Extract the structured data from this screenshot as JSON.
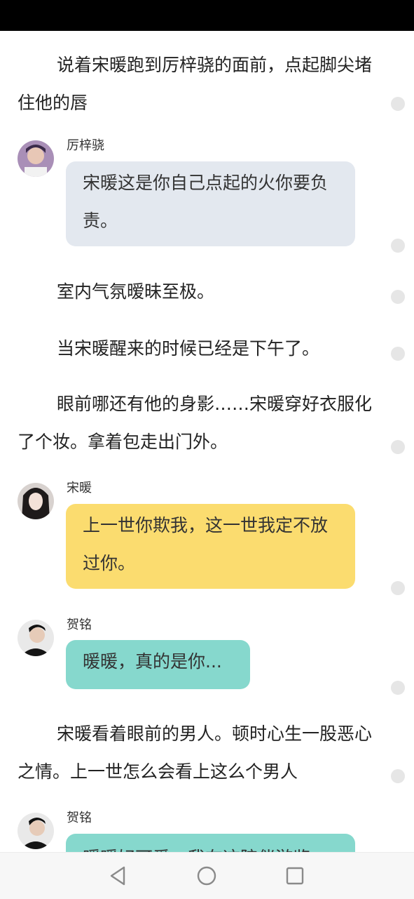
{
  "story": {
    "p1": "说着宋暖跑到厉梓骁的面前，点起脚尖堵住他的唇",
    "m1_speaker": "厉梓骁",
    "m1_text": "宋暖这是你自己点起的火你要负责。",
    "p2": "室内气氛暧昧至极。",
    "p3": "当宋暖醒来的时候已经是下午了。",
    "p4": "眼前哪还有他的身影……宋暖穿好衣服化了个妆。拿着包走出门外。",
    "m2_speaker": "宋暖",
    "m2_text": "上一世你欺我，这一世我定不放过你。",
    "m3_speaker": "贺铭",
    "m3_text": "暖暖，真的是你...",
    "p5": "宋暖看着眼前的男人。顿时心生一股恶心之情。上一世怎么会看上这么个男人",
    "m4_speaker": "贺铭",
    "m4_text": "暖暖好可爱，我在这陪伴游览"
  },
  "colors": {
    "bubble_grey": "#e3e8ef",
    "bubble_yellow": "#fbdc6f",
    "bubble_teal": "#86d8cd"
  },
  "nav": {
    "back_icon": "back-triangle-icon",
    "home_icon": "home-circle-icon",
    "recents_icon": "recents-square-icon"
  }
}
